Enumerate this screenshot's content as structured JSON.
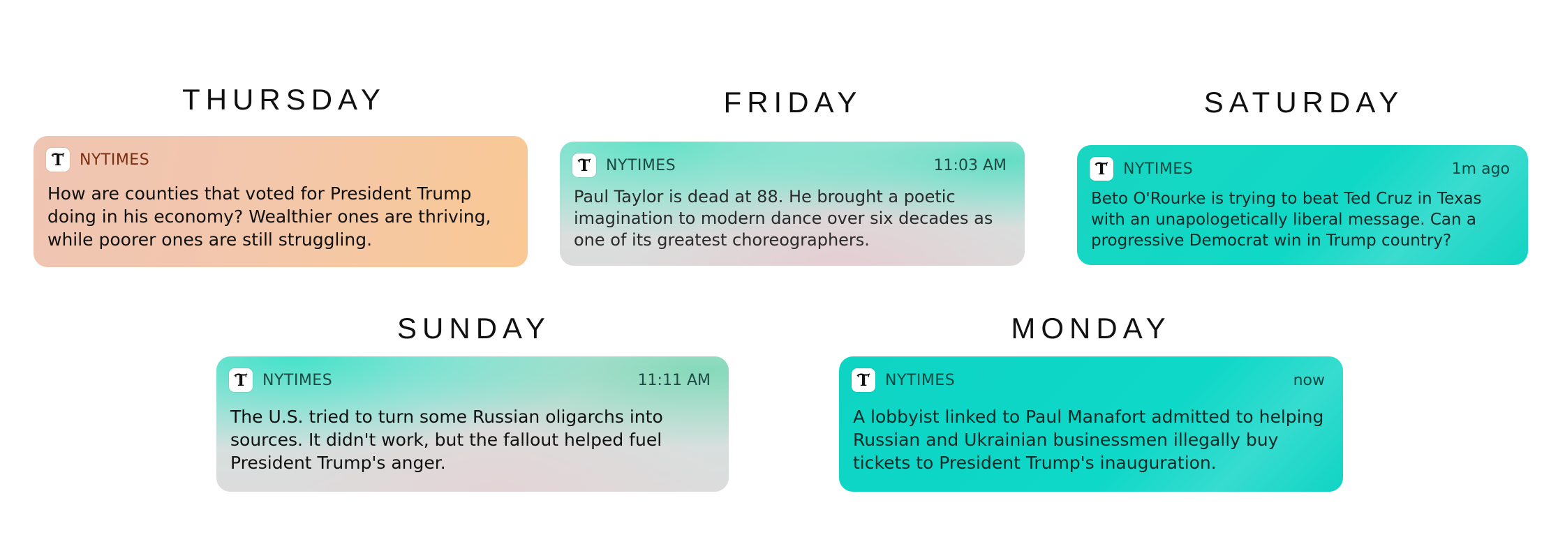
{
  "days": {
    "thursday": {
      "heading": "THURSDAY",
      "app_name": "NYTIMES",
      "time": "",
      "message": "How are counties that voted for President Trump doing in his economy? Wealthier ones are thriving, while poorer ones are still struggling."
    },
    "friday": {
      "heading": "FRIDAY",
      "app_name": "NYTIMES",
      "time": "11:03 AM",
      "message": "Paul Taylor is dead at 88. He brought a poetic imagination to modern dance over six decades as one of its greatest choreographers."
    },
    "saturday": {
      "heading": "SATURDAY",
      "app_name": "NYTIMES",
      "time": "1m ago",
      "message": "Beto O'Rourke is trying to beat Ted Cruz in Texas with an unapologetically liberal message. Can a progressive Democrat win in Trump country?"
    },
    "sunday": {
      "heading": "SUNDAY",
      "app_name": "NYTIMES",
      "time": "11:11 AM",
      "message": "The U.S. tried to turn some Russian oligarchs into sources. It didn't work, but the fallout helped fuel President Trump's anger."
    },
    "monday": {
      "heading": "MONDAY",
      "app_name": "NYTIMES",
      "time": "now",
      "message": "A lobbyist linked to Paul Manafort admitted to helping Russian and Ukrainian businessmen illegally buy tickets to President Trump's inauguration."
    }
  },
  "icons": {
    "app_icon": "nytimes-logo-icon"
  },
  "colors": {
    "thursday_card": "#f6c7a0",
    "teal_card": "#12d6c4",
    "mixed_card_grey": "#dcdcdc"
  }
}
